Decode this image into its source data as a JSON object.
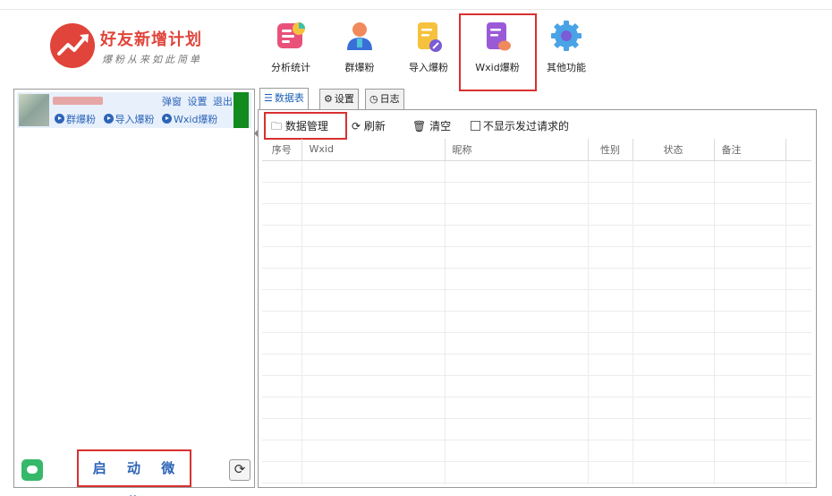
{
  "logo": {
    "title": "好友新增计划",
    "slogan": "爆粉从来如此简单"
  },
  "toolbar": {
    "items": [
      {
        "label": "分析统计",
        "icon": "analytics-icon"
      },
      {
        "label": "群爆粉",
        "icon": "group-user-icon"
      },
      {
        "label": "导入爆粉",
        "icon": "import-doc-icon"
      },
      {
        "label": "Wxid爆粉",
        "icon": "wxid-doc-icon"
      },
      {
        "label": "其他功能",
        "icon": "gear-icon"
      }
    ]
  },
  "account": {
    "actions": [
      "弹窗",
      "设置",
      "退出"
    ],
    "links": [
      "群爆粉",
      "导入爆粉",
      "Wxid爆粉"
    ]
  },
  "left_panel": {
    "start_label": "启 动 微 信"
  },
  "tabs": [
    "数据表",
    "设置",
    "日志"
  ],
  "actions": {
    "data_manage": "数据管理",
    "refresh": "刷新",
    "clear": "清空",
    "hide_sent": "不显示发过请求的"
  },
  "table": {
    "columns": [
      "序号",
      "Wxid",
      "昵称",
      "性别",
      "状态",
      "备注"
    ]
  },
  "colors": {
    "accent_red": "#d93030",
    "brand_red": "#e0443a",
    "link_blue": "#2d64b8",
    "status_green": "#118a1e"
  }
}
